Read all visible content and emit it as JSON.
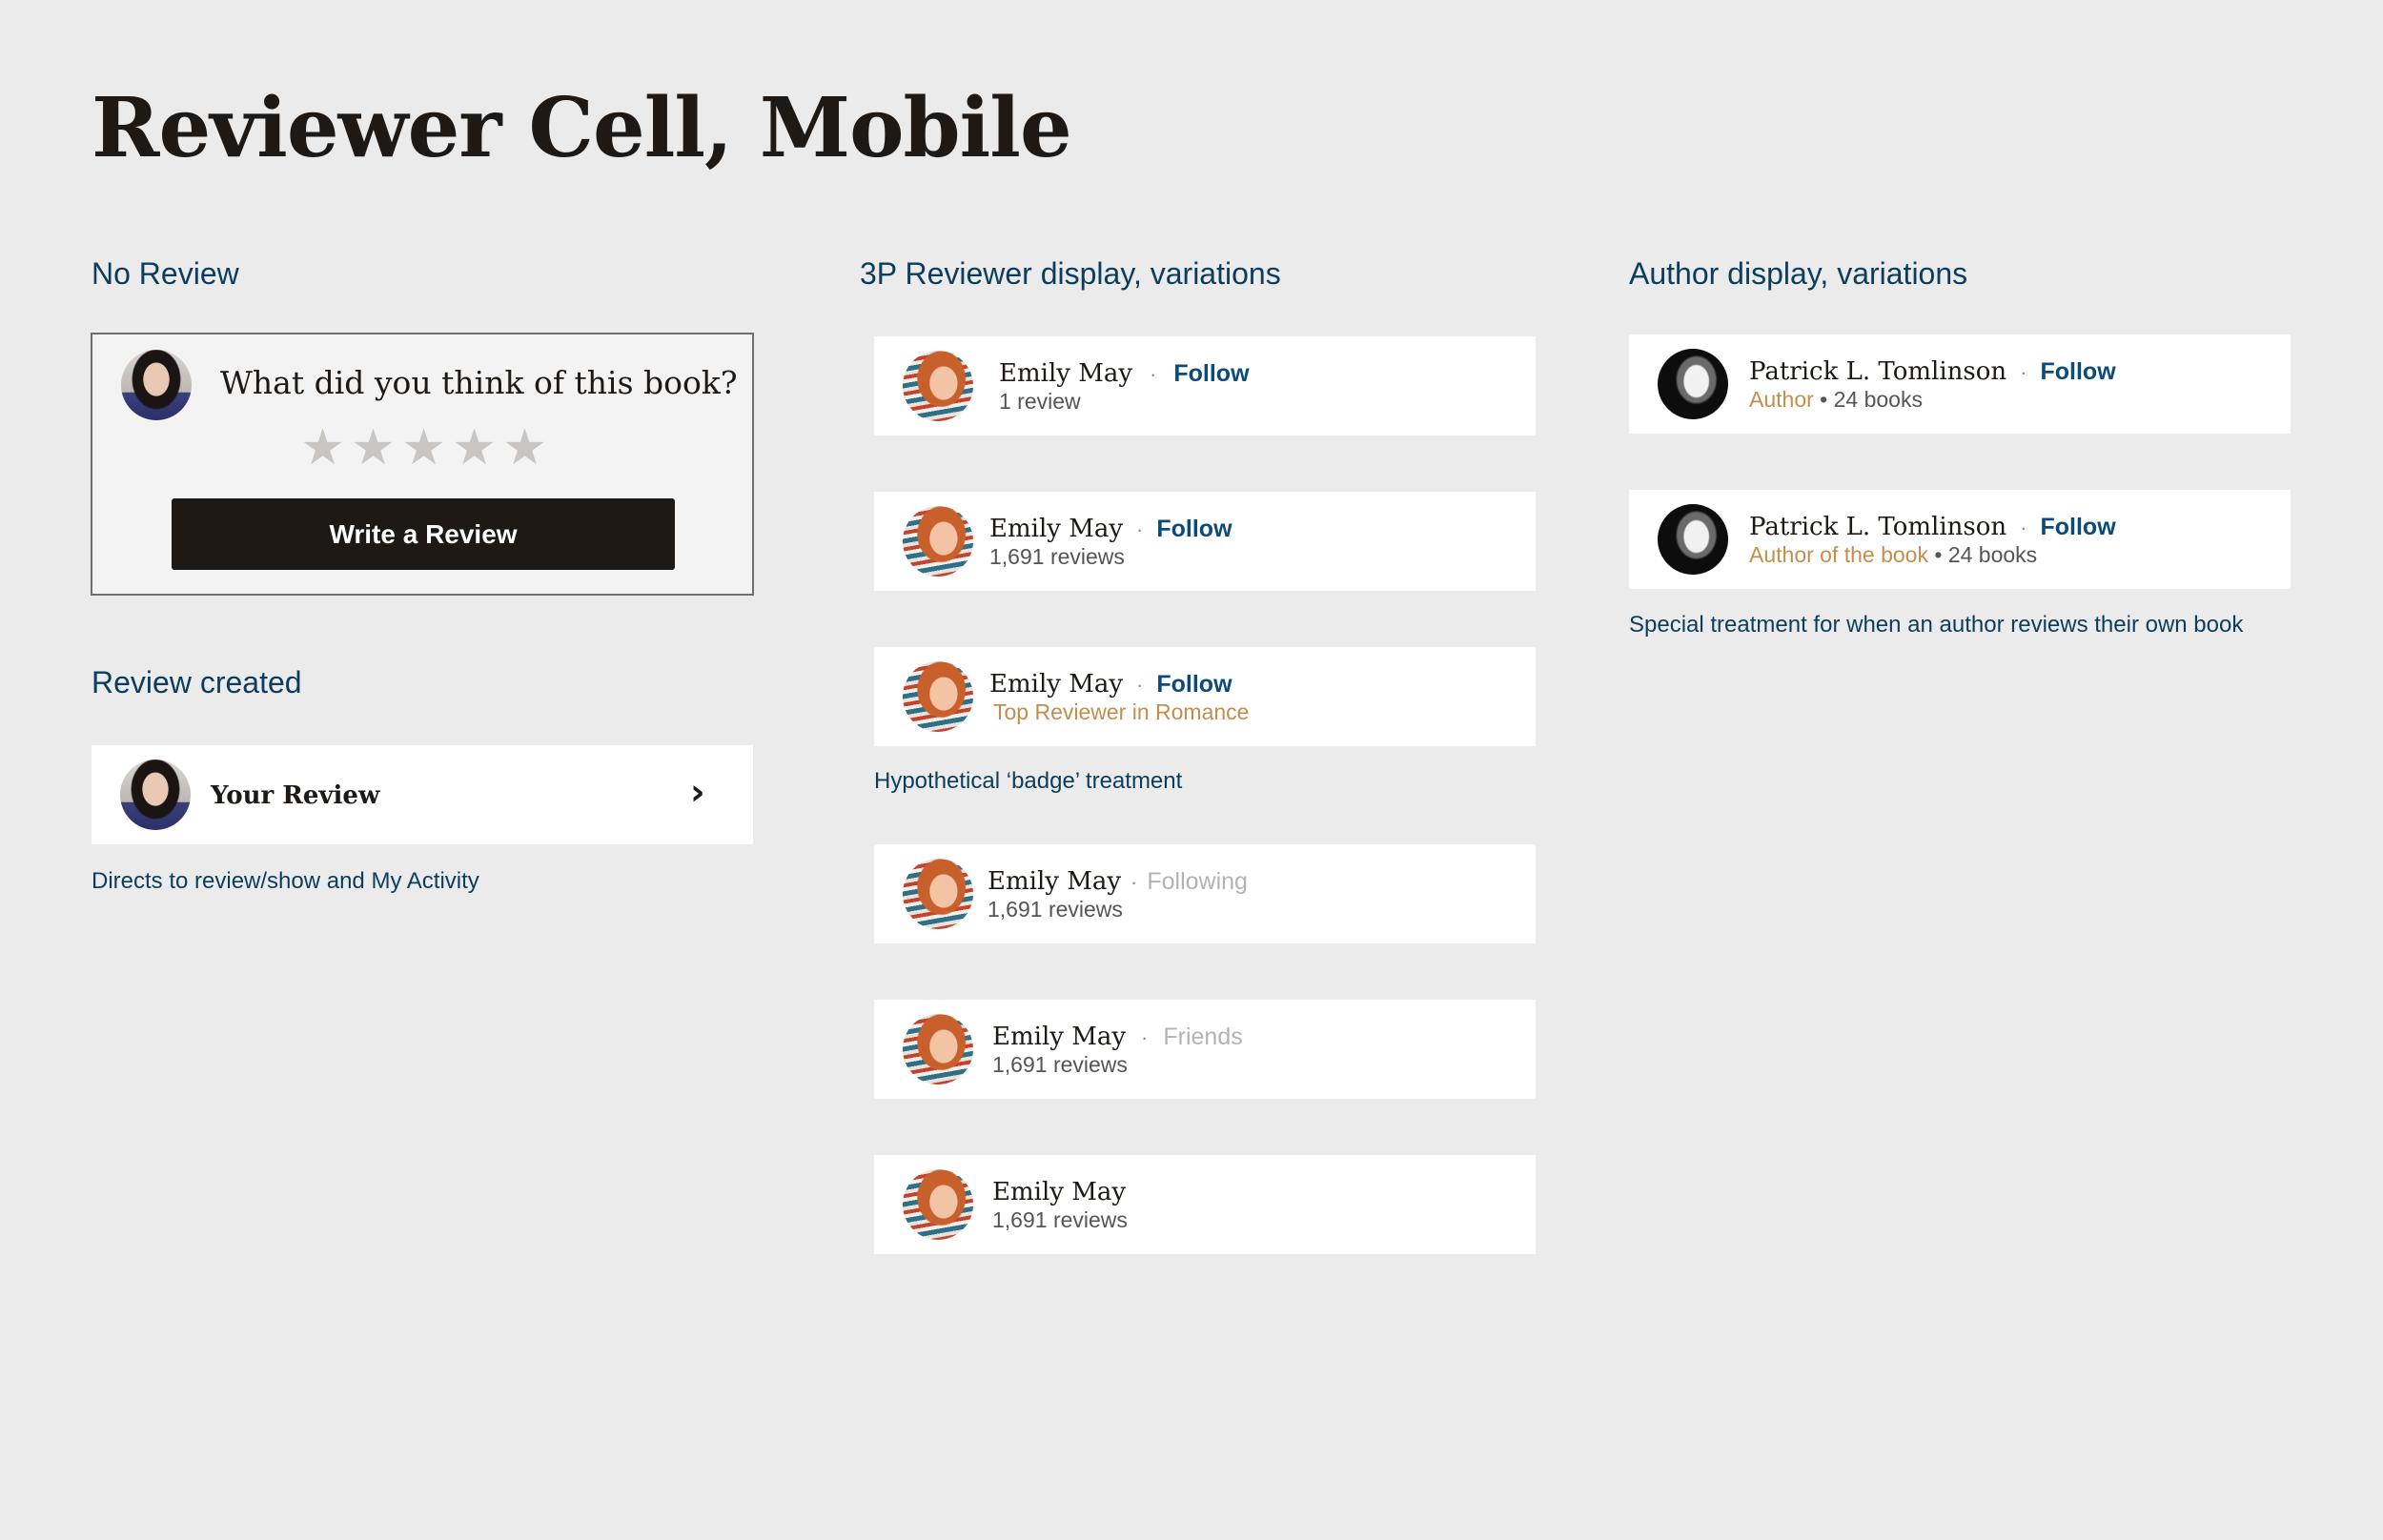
{
  "page": {
    "title": "Reviewer Cell, Mobile"
  },
  "sections": {
    "no_review": {
      "title": "No Review",
      "prompt": "What did you think of this book?",
      "stars": [
        "★",
        "★",
        "★",
        "★",
        "★"
      ],
      "button_label": "Write a Review"
    },
    "review_created": {
      "title": "Review created",
      "label": "Your Review",
      "caption": "Directs to review/show and My Activity"
    },
    "reviewer": {
      "title": "3P Reviewer display, variations",
      "badge_caption": "Hypothetical ‘badge’ treatment",
      "cells": [
        {
          "name": "Emily May",
          "dot": "·",
          "action": "Follow",
          "sub": "1 review"
        },
        {
          "name": "Emily May",
          "dot": "·",
          "action": "Follow",
          "sub": "1,691 reviews"
        },
        {
          "name": "Emily May",
          "dot": "·",
          "action": "Follow",
          "badge": "Top Reviewer in Romance"
        },
        {
          "name": "Emily May",
          "dot": "·",
          "action": "Following",
          "sub": "1,691 reviews"
        },
        {
          "name": "Emily May",
          "dot": "·",
          "action": "Friends",
          "sub": "1,691 reviews"
        },
        {
          "name": "Emily May",
          "sub": "1,691 reviews"
        }
      ]
    },
    "author": {
      "title": "Author display, variations",
      "caption": "Special treatment for when an author reviews their own book",
      "cells": [
        {
          "name": "Patrick L. Tomlinson",
          "dot": "·",
          "action": "Follow",
          "role": "Author",
          "sep": " • ",
          "books": "24 books"
        },
        {
          "name": "Patrick L. Tomlinson",
          "dot": "·",
          "action": "Follow",
          "role": "Author of the book",
          "sep": " • ",
          "books": "24 books"
        }
      ]
    }
  },
  "colors": {
    "background": "#ebebeb",
    "heading_blue": "#0c3d5c",
    "follow_blue": "#0c4a7a",
    "badge_gold": "#c38e4d",
    "muted_gray": "#b3b3b3",
    "dark_button": "#1e1915"
  },
  "icons": {
    "star": "star-icon",
    "chevron": "chevron-right-icon"
  }
}
